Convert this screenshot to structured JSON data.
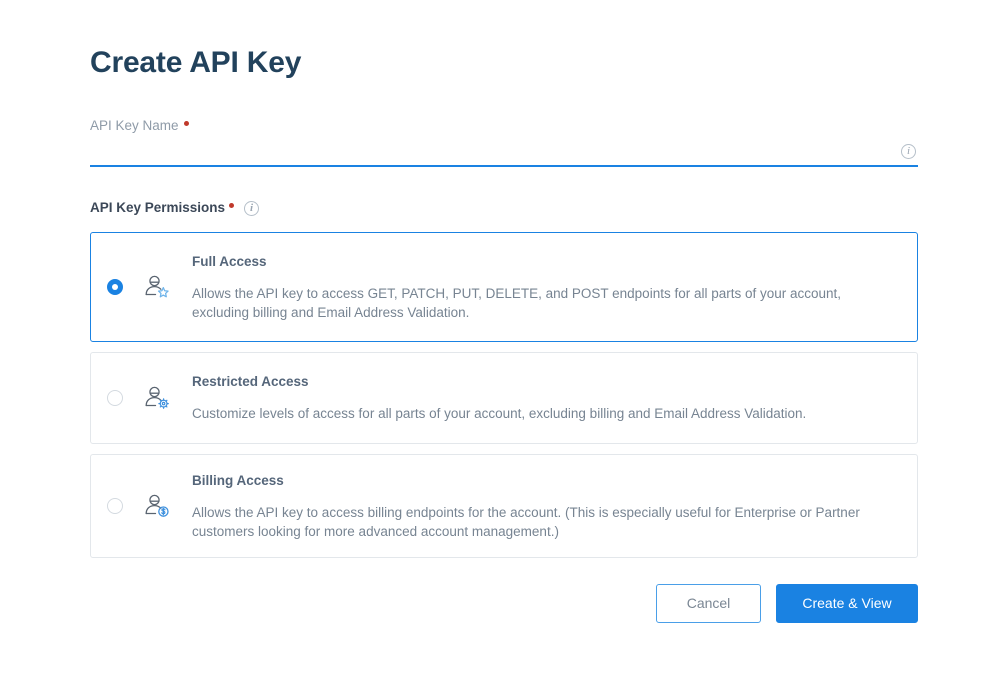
{
  "page": {
    "title": "Create API Key"
  },
  "name_field": {
    "label": "API Key Name",
    "required_marker": "•",
    "value": "",
    "placeholder": "",
    "info_icon": "info-circle-icon",
    "info_glyph": "i",
    "underline_color": "#1a82e2"
  },
  "permissions": {
    "label": "API Key Permissions",
    "required_marker": "•",
    "info_icon": "info-circle-icon",
    "info_glyph": "i",
    "selected": "full-access",
    "options": [
      {
        "id": "full-access",
        "title": "Full Access",
        "description": "Allows the API key to access GET, PATCH, PUT, DELETE, and POST endpoints for all parts of your account, excluding billing and Email Address Validation.",
        "icon": "user-star-icon",
        "selected": true
      },
      {
        "id": "restricted-access",
        "title": "Restricted Access",
        "description": "Customize levels of access for all parts of your account, excluding billing and Email Address Validation.",
        "icon": "user-gear-icon",
        "selected": false
      },
      {
        "id": "billing-access",
        "title": "Billing Access",
        "description": "Allows the API key to access billing endpoints for the account. (This is especially useful for Enterprise or Partner customers looking for more advanced account management.)",
        "icon": "user-billing-icon",
        "selected": false
      }
    ]
  },
  "actions": {
    "cancel_label": "Cancel",
    "submit_label": "Create & View"
  },
  "colors": {
    "accent": "#1a82e2",
    "title": "#22425c",
    "required": "#c0392b",
    "card_border": "#e3e7eb",
    "text_muted": "#778492"
  }
}
